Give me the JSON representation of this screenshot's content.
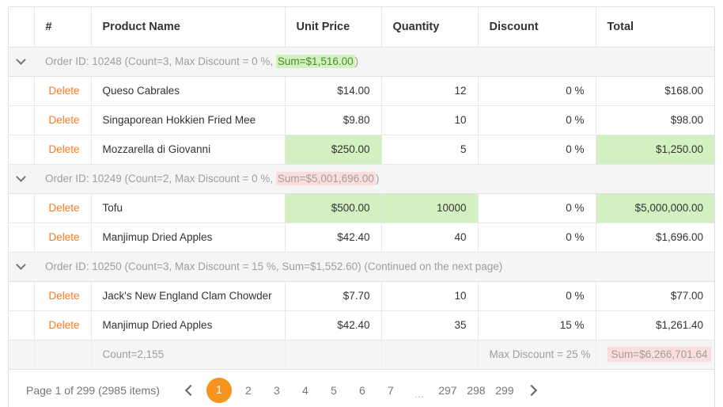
{
  "grid": {
    "columns": [
      {
        "key": "expand",
        "label": ""
      },
      {
        "key": "num",
        "label": "#"
      },
      {
        "key": "name",
        "label": "Product Name"
      },
      {
        "key": "price",
        "label": "Unit Price"
      },
      {
        "key": "qty",
        "label": "Quantity"
      },
      {
        "key": "discount",
        "label": "Discount"
      },
      {
        "key": "total",
        "label": "Total"
      }
    ],
    "delete_label": "Delete",
    "groups": [
      {
        "prefix": "Order ID: 10248 (Count=3, Max Discount = 0 %, ",
        "sum": "Sum=$1,516.00",
        "sum_style": "green",
        "suffix": ")",
        "tail": "",
        "rows": [
          {
            "name": "Queso Cabrales",
            "price": "$14.00",
            "qty": "12",
            "discount": "0 %",
            "total": "$168.00"
          },
          {
            "name": "Singaporean Hokkien Fried Mee",
            "price": "$9.80",
            "qty": "10",
            "discount": "0 %",
            "total": "$98.00"
          },
          {
            "name": "Mozzarella di Giovanni",
            "price": "$250.00",
            "qty": "5",
            "discount": "0 %",
            "total": "$1,250.00"
          }
        ]
      },
      {
        "prefix": "Order ID: 10249 (Count=2, Max Discount = 0 %, ",
        "sum": "Sum=$5,001,696.00",
        "sum_style": "pink",
        "suffix": ")",
        "tail": "",
        "rows": [
          {
            "name": "Tofu",
            "price": "$500.00",
            "qty": "10000",
            "discount": "0 %",
            "total": "$5,000,000.00"
          },
          {
            "name": "Manjimup Dried Apples",
            "price": "$42.40",
            "qty": "40",
            "discount": "0 %",
            "total": "$1,696.00"
          }
        ]
      },
      {
        "prefix": "Order ID: 10250 (Count=3, Max Discount = 15 %, Sum=$1,552.60) (Continued on the next page)",
        "sum": "",
        "sum_style": "none",
        "suffix": "",
        "tail": "",
        "rows": [
          {
            "name": "Jack's New England Clam Chowder",
            "price": "$7.70",
            "qty": "10",
            "discount": "0 %",
            "total": "$77.00"
          },
          {
            "name": "Manjimup Dried Apples",
            "price": "$42.40",
            "qty": "35",
            "discount": "15 %",
            "total": "$1,261.40"
          }
        ]
      }
    ],
    "footer": {
      "count": "Count=2,155",
      "max_discount": "Max Discount = 25 %",
      "sum": "Sum=$6,266,701.64"
    }
  },
  "pager": {
    "info": "Page 1 of 299 (2985 items)",
    "prev_icon": "chevron-left-icon",
    "next_icon": "chevron-right-icon",
    "pages": [
      "1",
      "2",
      "3",
      "4",
      "5",
      "6",
      "7",
      "…",
      "297",
      "298",
      "299"
    ],
    "active": "1"
  },
  "colors": {
    "accent": "#f7941e",
    "delete_link": "#f57c20",
    "highlight_green_bg": "#d3f0c0",
    "highlight_green_text": "#4a8c2a",
    "highlight_pink_bg": "#fbdddd",
    "group_bg": "#f5f5f5",
    "muted_text": "#9e9e9e"
  }
}
